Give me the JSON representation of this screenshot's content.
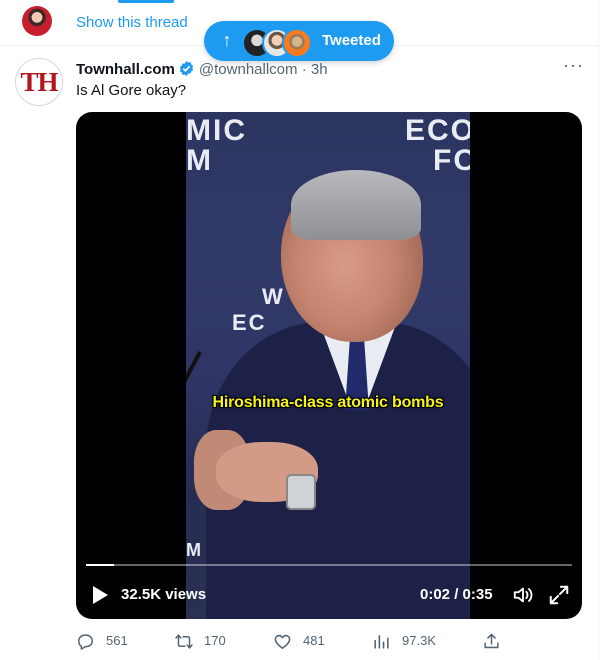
{
  "thread": {
    "link_label": "Show this thread"
  },
  "banner": {
    "label": "Tweeted"
  },
  "tweet": {
    "avatar_text": "TH",
    "display_name": "Townhall.com",
    "handle": "@townhallcom",
    "separator": "·",
    "time": "3h",
    "text": "Is Al Gore okay?",
    "video": {
      "logo_lines": [
        "MIC",
        "M",
        "ECO",
        "FO",
        "W",
        "EC",
        "M"
      ],
      "caption": "Hiroshima-class atomic bombs",
      "views": "32.5K views",
      "time_display": "0:02 / 0:35",
      "progress": 0.057
    },
    "stats": {
      "replies": "561",
      "retweets": "170",
      "likes": "481",
      "views": "97.3K"
    }
  },
  "colors": {
    "accent": "#1d9bf0",
    "caption_yellow": "#f6f31d",
    "brand_red": "#b3151c"
  }
}
